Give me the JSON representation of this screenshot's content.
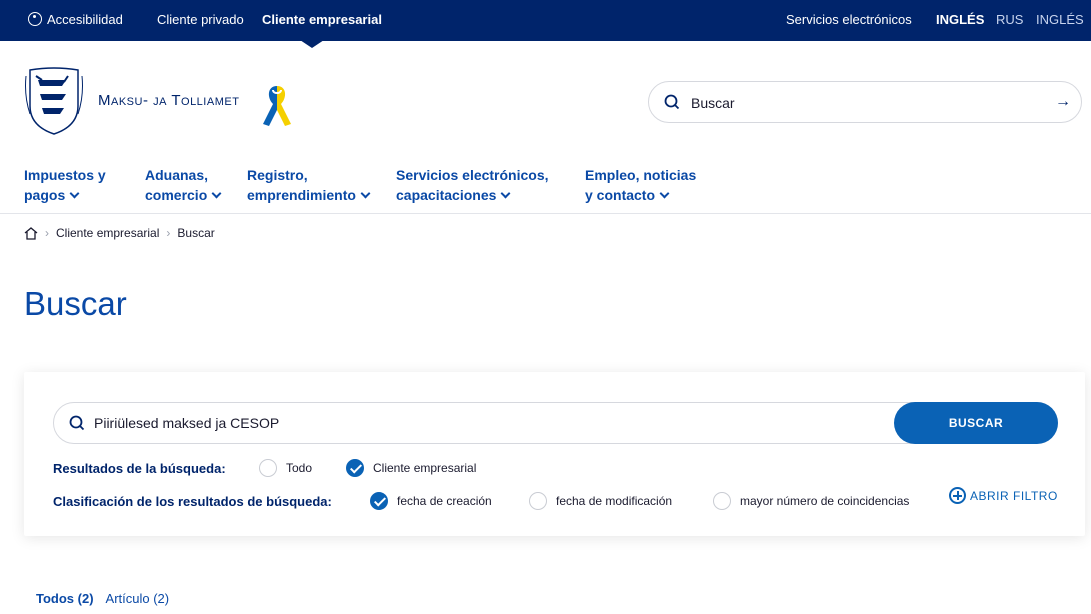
{
  "topbar": {
    "accessibility": "Accesibilidad",
    "private_client": "Cliente privado",
    "business_client": "Cliente empresarial",
    "e_services": "Servicios electrónicos",
    "lang_active": "INGLÉS",
    "lang_rus": "RUS",
    "lang_english": "INGLÉS"
  },
  "header": {
    "logo_text": "Maksu- ja Tolliamet",
    "search_placeholder": "Buscar"
  },
  "nav": [
    {
      "line1": "Impuestos y",
      "line2": "pagos"
    },
    {
      "line1": "Aduanas,",
      "line2": "comercio"
    },
    {
      "line1": "Registro,",
      "line2": "emprendimiento"
    },
    {
      "line1": "Servicios electrónicos,",
      "line2": "capacitaciones"
    },
    {
      "line1": "Empleo, noticias",
      "line2": "y contacto"
    }
  ],
  "breadcrumb": [
    "Cliente empresarial",
    "Buscar"
  ],
  "page_title": "Buscar",
  "search_card": {
    "query": "Piiriülesed maksed ja CESOP",
    "button": "BUSCAR",
    "results_label": "Resultados de la búsqueda:",
    "results_options": [
      {
        "label": "Todo",
        "checked": false
      },
      {
        "label": "Cliente empresarial",
        "checked": true
      }
    ],
    "sort_label": "Clasificación de los resultados de búsqueda:",
    "sort_options": [
      {
        "label": "fecha de creación",
        "checked": true
      },
      {
        "label": "fecha de modificación",
        "checked": false
      },
      {
        "label": "mayor número de coincidencias",
        "checked": false
      }
    ],
    "filter_button": "ABRIR FILTRO"
  },
  "tabs": [
    "Todos (2)",
    "Artículo (2)"
  ]
}
